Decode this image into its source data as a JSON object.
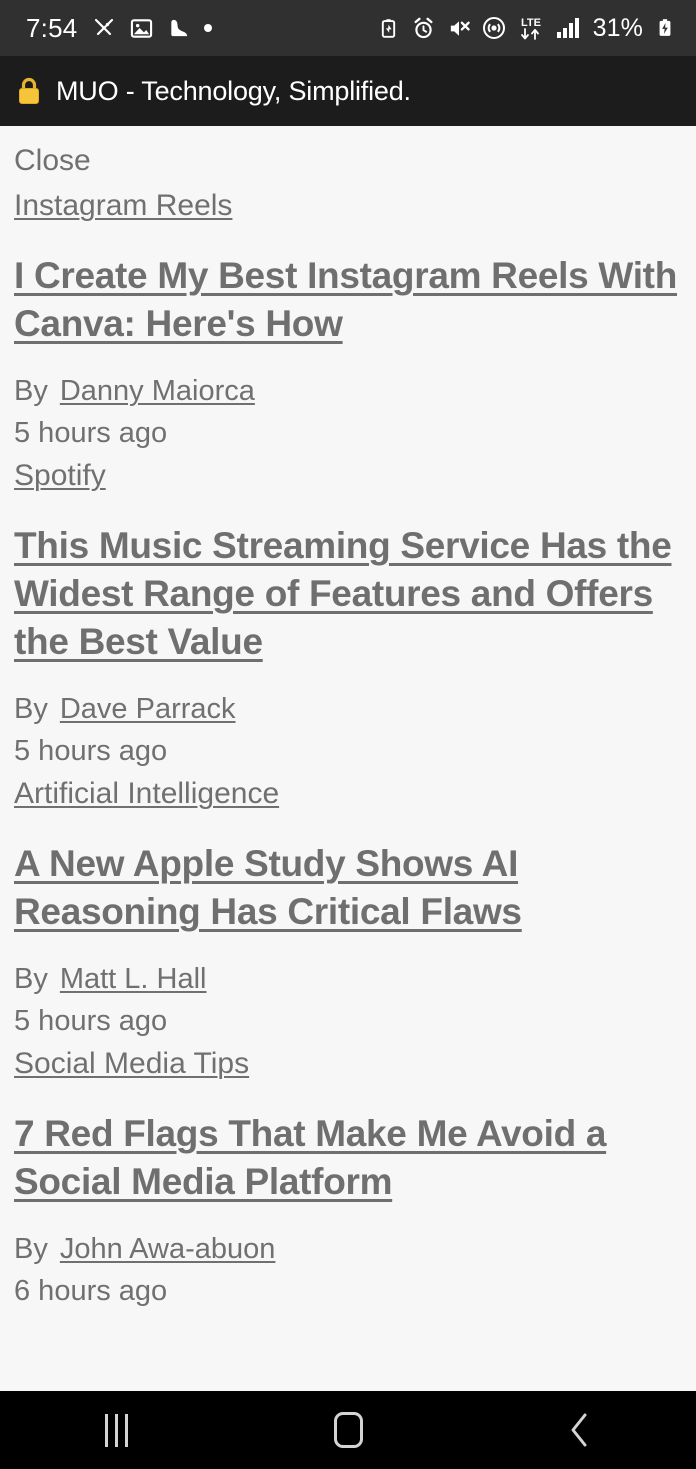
{
  "status_bar": {
    "clock": "7:54",
    "battery_percent": "31%",
    "network_type": "LTE",
    "left_icons": [
      "crossed-tools-icon",
      "image-gallery-icon",
      "boot-icon",
      "dot-indicator-icon"
    ],
    "right_icons": [
      "battery-saver-icon",
      "alarm-clock-icon",
      "volume-mute-icon",
      "hotspot-icon",
      "lte-data-icon",
      "signal-bars-icon",
      "battery-charging-icon"
    ],
    "background_color": "#303030",
    "text_color": "#ffffff"
  },
  "title_bar": {
    "lock_icon": "lock-icon",
    "title": "MUO - Technology, Simplified.",
    "background_color": "#1c1c1c",
    "text_color": "#ffffff"
  },
  "content": {
    "close_label": "Close",
    "text_color": "#707070",
    "background_color": "#f7f7f7",
    "articles": [
      {
        "category": "Instagram Reels",
        "headline": "I Create My Best Instagram Reels With Canva: Here's How",
        "by_word": "By",
        "author": "Danny Maiorca",
        "timestamp": "5 hours ago"
      },
      {
        "category": "Spotify",
        "headline": "This Music Streaming Service Has the Widest Range of Features and Offers the Best Value",
        "by_word": "By",
        "author": "Dave Parrack",
        "timestamp": "5 hours ago"
      },
      {
        "category": "Artificial Intelligence",
        "headline": "A New Apple Study Shows AI Reasoning Has Critical Flaws",
        "by_word": "By",
        "author": "Matt L. Hall",
        "timestamp": "5 hours ago"
      },
      {
        "category": "Social Media Tips",
        "headline": "7 Red Flags That Make Me Avoid a Social Media Platform",
        "by_word": "By",
        "author": "John Awa-abuon",
        "timestamp": "6 hours ago"
      }
    ]
  },
  "nav_bar": {
    "recents_label": "recent-apps",
    "home_label": "home",
    "back_label": "back",
    "background_color": "#000000"
  }
}
